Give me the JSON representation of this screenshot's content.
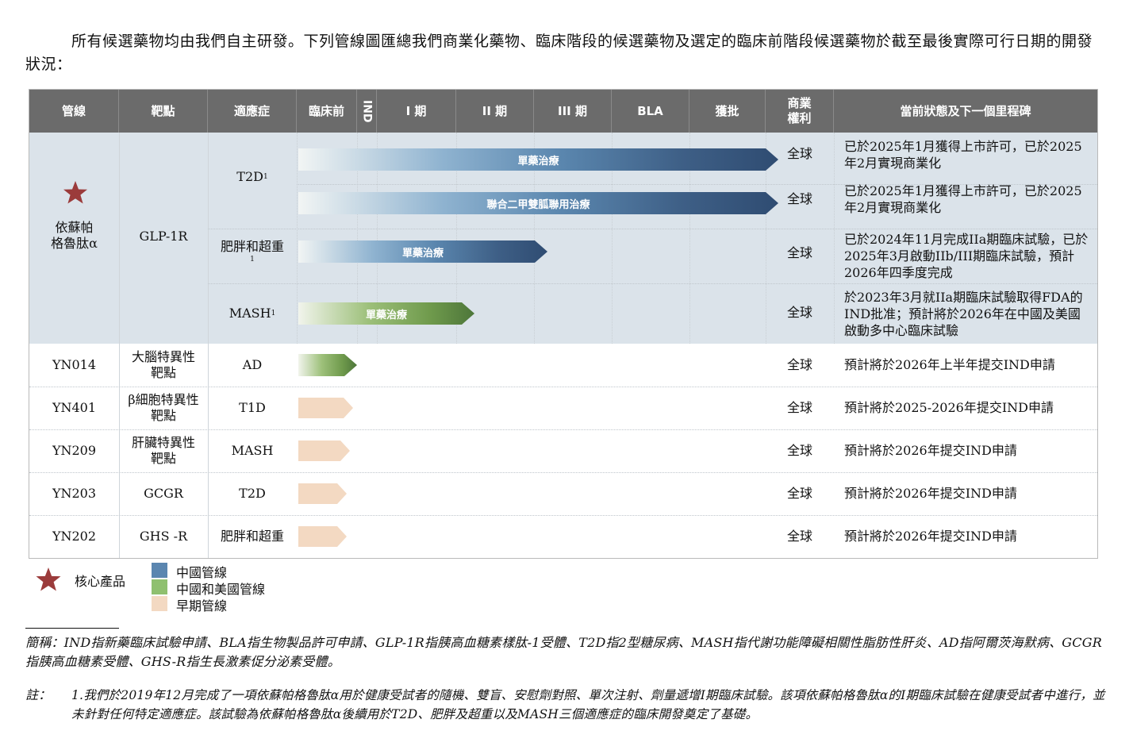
{
  "intro_text": "所有候選藥物均由我們自主研發。下列管線圖匯總我們商業化藥物、臨床階段的候選藥物及選定的臨床前階段候選藥物於截至最後實際可行日期的開發狀況：",
  "headers": {
    "pipeline": "管線",
    "target": "靶點",
    "indication": "適應症",
    "preclinical": "臨床前",
    "ind": "IND",
    "phase1": "I 期",
    "phase2": "II 期",
    "phase3": "III 期",
    "bla": "BLA",
    "approved": "獲批",
    "rights": "商業\n權利",
    "status": "當前狀態及下一個里程碑"
  },
  "ecnoglutide": {
    "name": "依蘇帕\n格魯肽α",
    "target": "GLP-1R",
    "rows": [
      {
        "indication": "T2D",
        "sup": "1",
        "arrow_label": "單藥治療",
        "rights": "全球",
        "status": "已於2025年1月獲得上市許可，已於2025年2月實現商業化"
      },
      {
        "indication": "",
        "sup": "",
        "arrow_label": "聯合二甲雙胍聯用治療",
        "rights": "全球",
        "status": "已於2025年1月獲得上市許可，已於2025年2月實現商業化"
      },
      {
        "indication": "肥胖和超重",
        "sup": "1",
        "arrow_label": "單藥治療",
        "rights": "全球",
        "status": "已於2024年11月完成IIa期臨床試驗，已於2025年3月啟動IIb/III期臨床試驗，預計2026年四季度完成"
      },
      {
        "indication": "MASH",
        "sup": "1",
        "arrow_label": "單藥治療",
        "rights": "全球",
        "status": "於2023年3月就IIa期臨床試驗取得FDA的IND批准；預計將於2026年在中國及美國啟動多中心臨床試驗"
      }
    ]
  },
  "early_rows": [
    {
      "code": "YN014",
      "target": "大腦特異性靶點",
      "indication": "AD",
      "rights": "全球",
      "status": "預計將於2026年上半年提交IND申請"
    },
    {
      "code": "YN401",
      "target": "β細胞特異性靶點",
      "indication": "T1D",
      "rights": "全球",
      "status": "預計將於2025-2026年提交IND申請"
    },
    {
      "code": "YN209",
      "target": "肝臟特異性靶點",
      "indication": "MASH",
      "rights": "全球",
      "status": "預計將於2026年提交IND申請"
    },
    {
      "code": "YN203",
      "target": "GCGR",
      "indication": "T2D",
      "rights": "全球",
      "status": "預計將於2026年提交IND申請"
    },
    {
      "code": "YN202",
      "target": "GHS -R",
      "indication": "肥胖和超重",
      "rights": "全球",
      "status": "預計將於2026年提交IND申請"
    }
  ],
  "legend": {
    "core": "核心產品",
    "china": "中國管線",
    "china_us": "中國和美國管線",
    "early": "早期管線"
  },
  "colors": {
    "header_bg": "#6b6b6b",
    "band_bg": "#dbe3ea",
    "star": "#9b3b3b",
    "china": "#5b86b0",
    "china_us": "#8fc06f",
    "early": "#f3d9c2"
  },
  "abbrev": "簡稱：IND指新藥臨床試驗申請、BLA指生物製品許可申請、GLP-1R指胰高血糖素樣肽-1受體、T2D指2型糖尿病、MASH指代謝功能障礙相關性脂肪性肝炎、AD指阿爾茨海默病、GCGR指胰高血糖素受體、GHS-R指生長激素促分泌素受體。",
  "note_label": "註：",
  "note_text": "1.我們於2019年12月完成了一項依蘇帕格魯肽α用於健康受試者的隨機、雙盲、安慰劑對照、單次注射、劑量遞增I期臨床試驗。該項依蘇帕格魯肽α的I期臨床試驗在健康受試者中進行，並未針對任何特定適應症。該試驗為依蘇帕格魯肽α後續用於T2D、肥胖及超重以及MASH三個適應症的臨床開發奠定了基礎。"
}
